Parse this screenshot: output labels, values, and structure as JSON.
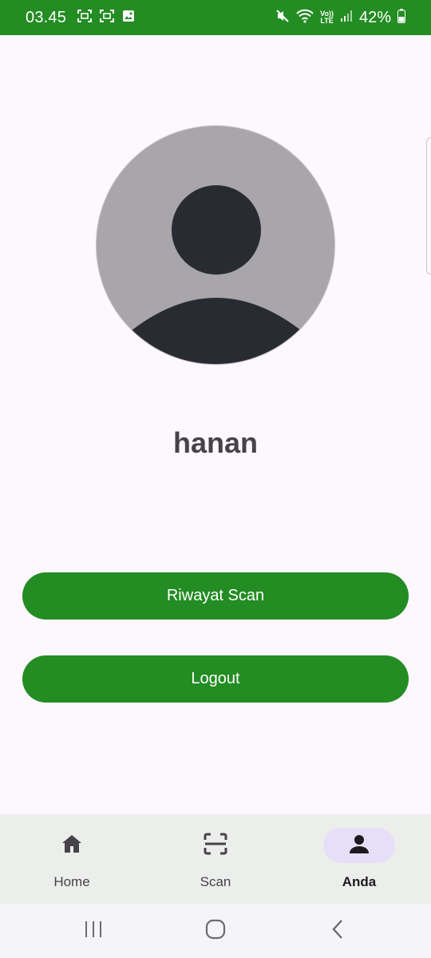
{
  "status_bar": {
    "time": "03.45",
    "volte_top": "Vo))",
    "volte_bottom": "LTE",
    "battery": "42%"
  },
  "profile": {
    "username": "hanan"
  },
  "actions": {
    "history_label": "Riwayat Scan",
    "logout_label": "Logout"
  },
  "bottom_nav": {
    "items": [
      {
        "label": "Home",
        "icon": "home-icon",
        "active": false
      },
      {
        "label": "Scan",
        "icon": "scan-icon",
        "active": false
      },
      {
        "label": "Anda",
        "icon": "person-icon",
        "active": true
      }
    ]
  },
  "colors": {
    "primary": "#238c23",
    "background": "#fdf7fe",
    "nav_background": "#eceeec",
    "active_indicator": "#e7dff8",
    "avatar_bg": "#a9a6ab",
    "avatar_figure": "#292b33"
  }
}
